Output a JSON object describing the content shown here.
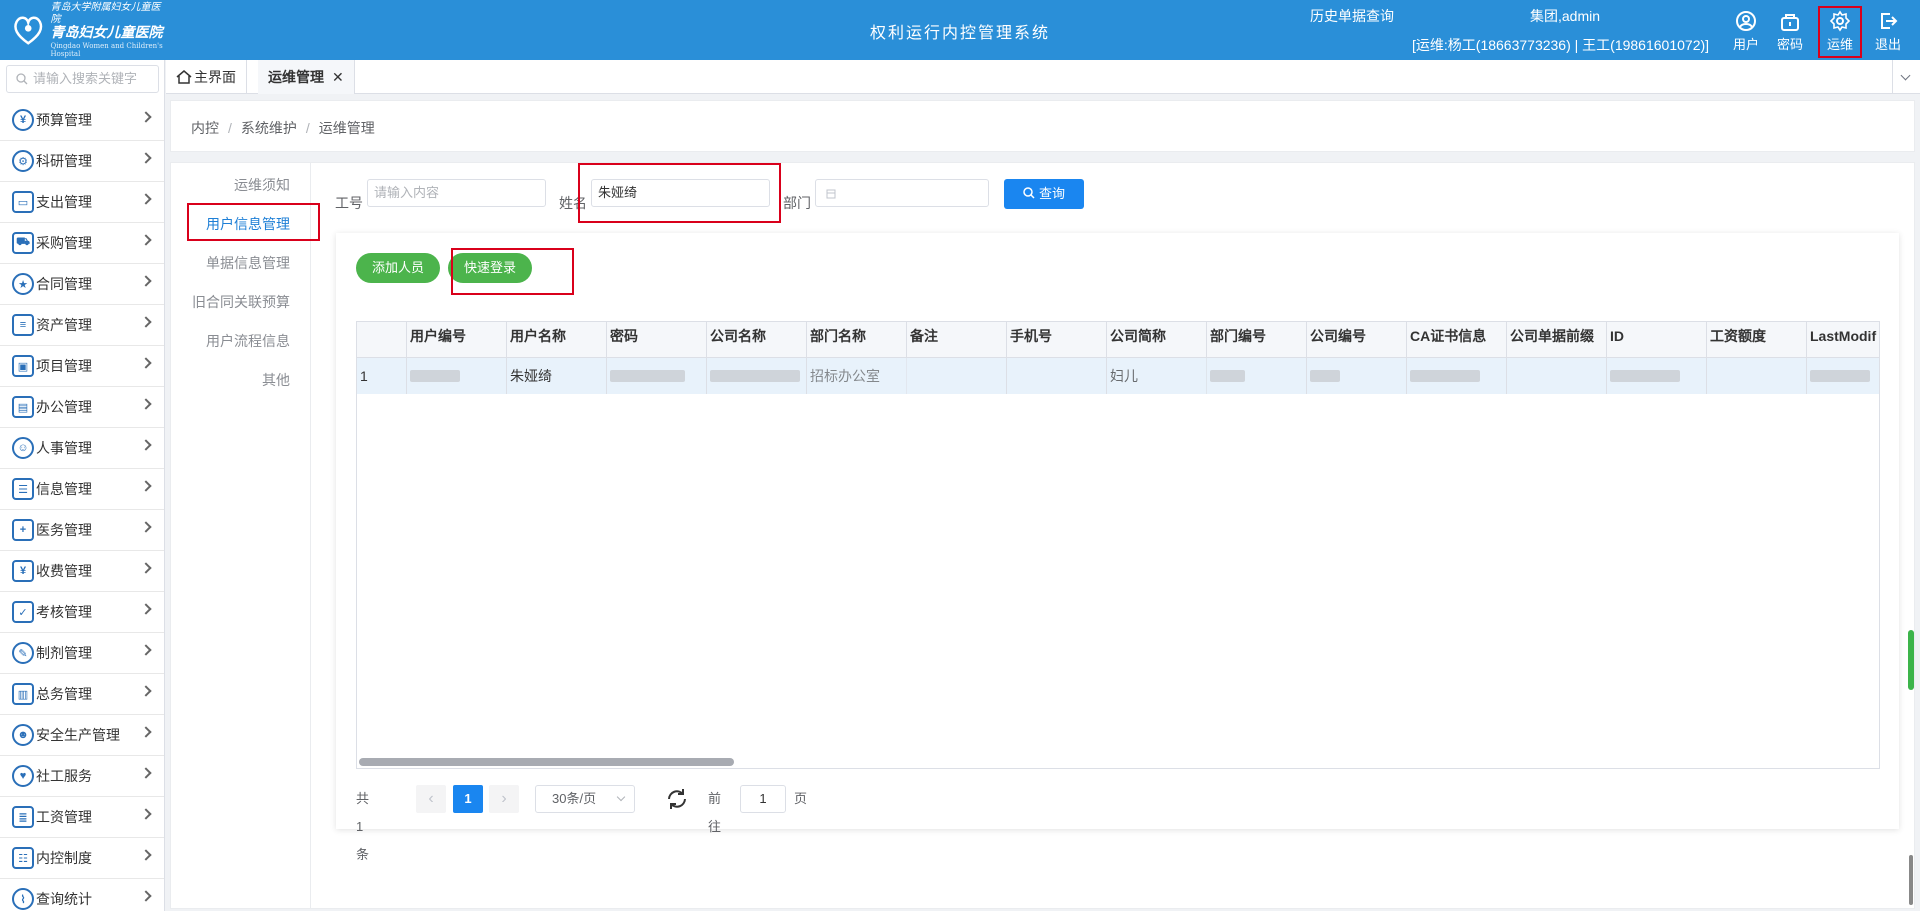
{
  "header": {
    "logo_line1": "青岛大学附属妇女儿童医院",
    "logo_line2": "青岛妇女儿童医院",
    "logo_line3": "Qingdao Women and Children's Hospital",
    "system_title": "权利运行内控管理系统",
    "history_link": "历史单据查询",
    "user_name": "集团,admin",
    "support_info": "[运维:杨工(18663773236) | 王工(19861601072)]",
    "buttons": [
      {
        "label": "用户",
        "icon": "user-icon"
      },
      {
        "label": "密码",
        "icon": "lock-icon"
      },
      {
        "label": "运维",
        "icon": "gear-icon"
      },
      {
        "label": "退出",
        "icon": "logout-icon"
      }
    ]
  },
  "sidebar": {
    "search_placeholder": "请输入搜索关键字",
    "items": [
      {
        "label": "预算管理",
        "icon": "budget-icon"
      },
      {
        "label": "科研管理",
        "icon": "research-icon"
      },
      {
        "label": "支出管理",
        "icon": "card-icon"
      },
      {
        "label": "采购管理",
        "icon": "cart-icon"
      },
      {
        "label": "合同管理",
        "icon": "contract-icon"
      },
      {
        "label": "资产管理",
        "icon": "database-icon"
      },
      {
        "label": "项目管理",
        "icon": "briefcase-icon"
      },
      {
        "label": "办公管理",
        "icon": "office-icon"
      },
      {
        "label": "人事管理",
        "icon": "people-icon"
      },
      {
        "label": "信息管理",
        "icon": "message-icon"
      },
      {
        "label": "医务管理",
        "icon": "medical-icon"
      },
      {
        "label": "收费管理",
        "icon": "yen-icon"
      },
      {
        "label": "考核管理",
        "icon": "checklist-icon"
      },
      {
        "label": "制剂管理",
        "icon": "medicine-icon"
      },
      {
        "label": "总务管理",
        "icon": "building-icon"
      },
      {
        "label": "安全生产管理",
        "icon": "safety-icon"
      },
      {
        "label": "社工服务",
        "icon": "heart-icon"
      },
      {
        "label": "工资管理",
        "icon": "salary-icon"
      },
      {
        "label": "内控制度",
        "icon": "rules-icon"
      },
      {
        "label": "查询统计",
        "icon": "thermometer-icon"
      }
    ]
  },
  "tabs": [
    {
      "label": "主界面"
    },
    {
      "label": "运维管理",
      "close": "✕"
    }
  ],
  "breadcrumb": [
    "内控",
    "系统维护",
    "运维管理"
  ],
  "subnav": [
    "运维须知",
    "用户信息管理",
    "单据信息管理",
    "旧合同关联预算",
    "用户流程信息",
    "其他"
  ],
  "filters": {
    "job_no_label": "工号",
    "job_no_placeholder": "请输入内容",
    "name_label": "姓名",
    "name_value": "朱娅绮",
    "dept_label": "部门",
    "query_label": "查询"
  },
  "actions": {
    "add_label": "添加人员",
    "quick_login_label": "快速登录"
  },
  "table": {
    "columns": [
      "用户编号",
      "用户名称",
      "密码",
      "公司名称",
      "部门名称",
      "备注",
      "手机号",
      "公司简称",
      "部门编号",
      "公司编号",
      "CA证书信息",
      "公司单据前缀",
      "ID",
      "工资额度",
      "LastModif"
    ],
    "rows": [
      {
        "index": "1",
        "user_name": "朱娅绮",
        "dept_name": "招标办公室",
        "company_short": "妇儿"
      }
    ]
  },
  "pagination": {
    "total": "共 1 条",
    "current": "1",
    "page_size": "30条/页",
    "goto_label": "前往",
    "goto_value": "1",
    "page_suffix": "页"
  },
  "colors": {
    "header_bg": "#2a8fd8",
    "primary": "#1a86f0",
    "green": "#4cb44c",
    "highlight_red": "#d9001b"
  }
}
